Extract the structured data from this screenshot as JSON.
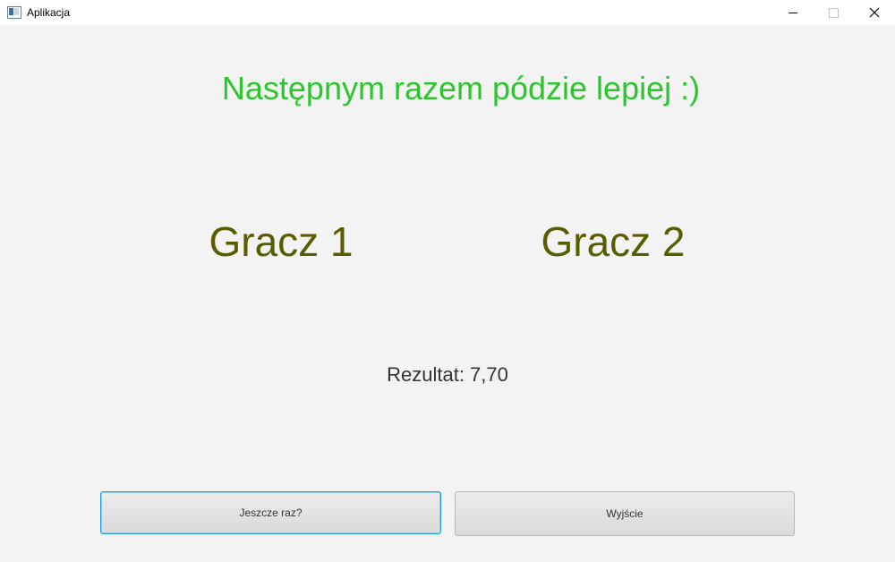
{
  "window": {
    "title": "Aplikacja",
    "controls": [
      "minimize-icon",
      "maximize-icon",
      "close-icon"
    ]
  },
  "main": {
    "headline": "Następnym razem pódzie lepiej :)",
    "players": [
      "Gracz 1",
      "Gracz 2"
    ],
    "result": "Rezultat: 7,70"
  },
  "actions": {
    "again_label": "Jeszcze raz?",
    "exit_label": "Wyjście"
  },
  "colors": {
    "headline": "#2dc52d",
    "players": "#5a5c00",
    "focus_border": "#1e9bd6"
  }
}
